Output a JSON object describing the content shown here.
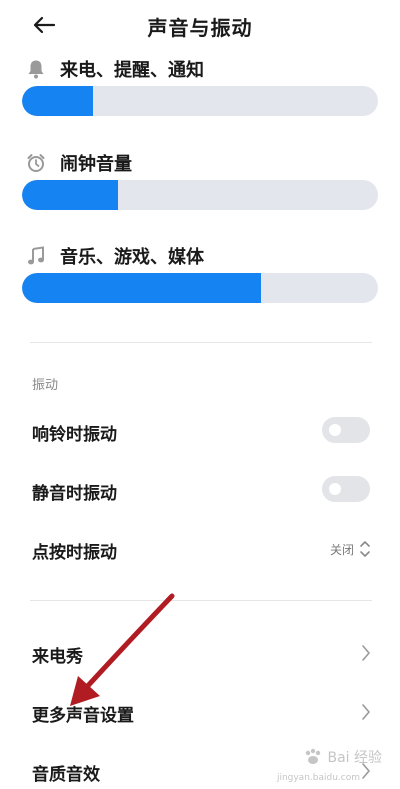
{
  "header": {
    "title": "声音与振动",
    "back_icon": "back-arrow-icon"
  },
  "volume": {
    "items": [
      {
        "label": "来电、提醒、通知",
        "icon": "bell-icon",
        "level": 0.2
      },
      {
        "label": "闹钟音量",
        "icon": "alarm-clock-icon",
        "level": 0.27
      },
      {
        "label": "音乐、游戏、媒体",
        "icon": "music-note-icon",
        "level": 0.67
      }
    ],
    "accent_color": "#1584f2",
    "track_color": "#e3e6ec"
  },
  "vibration": {
    "section_label": "振动",
    "ring_vibrate": {
      "label": "响铃时振动",
      "on": false
    },
    "silent_vibrate": {
      "label": "静音时振动",
      "on": false
    },
    "touch_vibrate": {
      "label": "点按时振动",
      "value": "关闭"
    }
  },
  "more": {
    "items": [
      {
        "label": "来电秀"
      },
      {
        "label": "更多声音设置"
      },
      {
        "label": "音质音效"
      }
    ]
  },
  "watermark": {
    "brand": "Bai 经验",
    "url": "jingyan.baidu.com"
  },
  "annotation_arrow_color": "#b01c22"
}
